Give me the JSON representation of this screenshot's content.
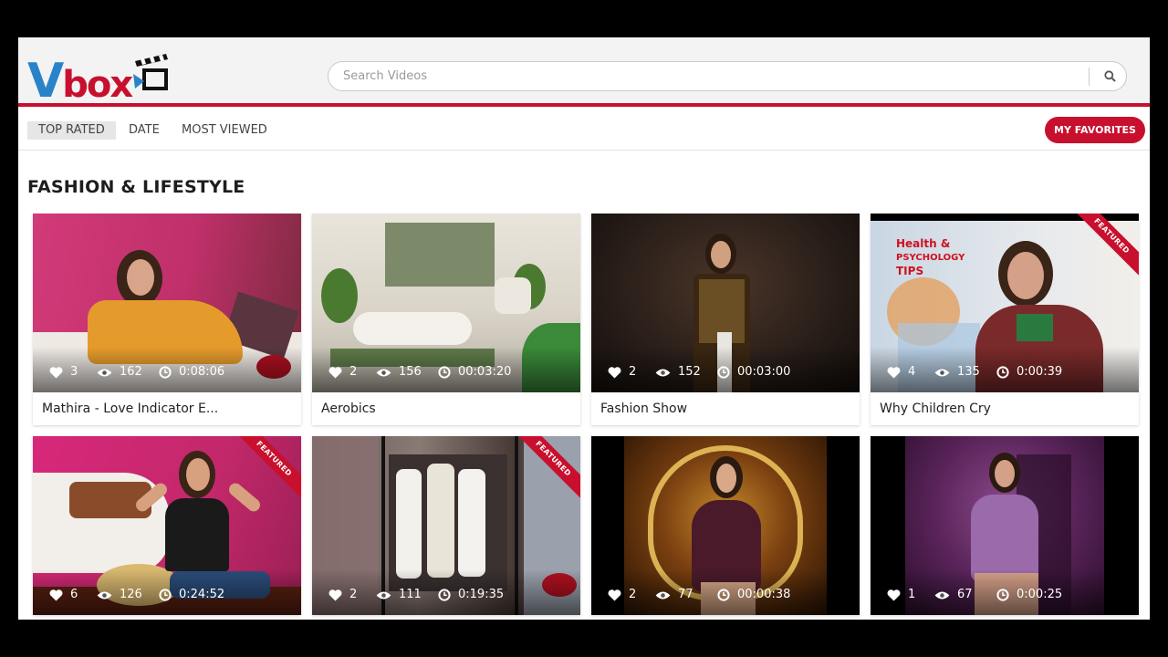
{
  "brand": {
    "logo_v": "V",
    "logo_box": "box",
    "colors": {
      "blue": "#2a83c8",
      "red": "#c8102e"
    }
  },
  "search": {
    "placeholder": "Search Videos",
    "icon": "search-icon"
  },
  "toolbar": {
    "tabs": [
      {
        "label": "TOP RATED",
        "active": true
      },
      {
        "label": "DATE",
        "active": false
      },
      {
        "label": "MOST VIEWED",
        "active": false
      }
    ],
    "favorites_label": "MY FAVORITES"
  },
  "section": {
    "title": "FASHION & LIFESTYLE"
  },
  "videos": [
    {
      "title": "Mathira - Love Indicator E...",
      "likes": "3",
      "views": "162",
      "duration": "0:08:06",
      "featured": false,
      "bg": "#c0306a"
    },
    {
      "title": "Aerobics",
      "likes": "2",
      "views": "156",
      "duration": "00:03:20",
      "featured": false,
      "bg": "#b9b7ac"
    },
    {
      "title": "Fashion Show",
      "likes": "2",
      "views": "152",
      "duration": "00:03:00",
      "featured": false,
      "bg": "#2a1f1a"
    },
    {
      "title": "Why Children Cry",
      "likes": "4",
      "views": "135",
      "duration": "0:00:39",
      "featured": true,
      "featured_label": "FEATURED",
      "bg": "#d7dde4"
    },
    {
      "title": "",
      "likes": "6",
      "views": "126",
      "duration": "0:24:52",
      "featured": true,
      "featured_label": "FEATURED",
      "bg": "#c2286a"
    },
    {
      "title": "",
      "likes": "2",
      "views": "111",
      "duration": "0:19:35",
      "featured": true,
      "featured_label": "FEATURED",
      "bg": "#5e4a44"
    },
    {
      "title": "",
      "likes": "2",
      "views": "77",
      "duration": "00:00:38",
      "featured": false,
      "bg": "#3a200c"
    },
    {
      "title": "",
      "likes": "1",
      "views": "67",
      "duration": "0:00:25",
      "featured": false,
      "bg": "#3c1e42"
    }
  ]
}
